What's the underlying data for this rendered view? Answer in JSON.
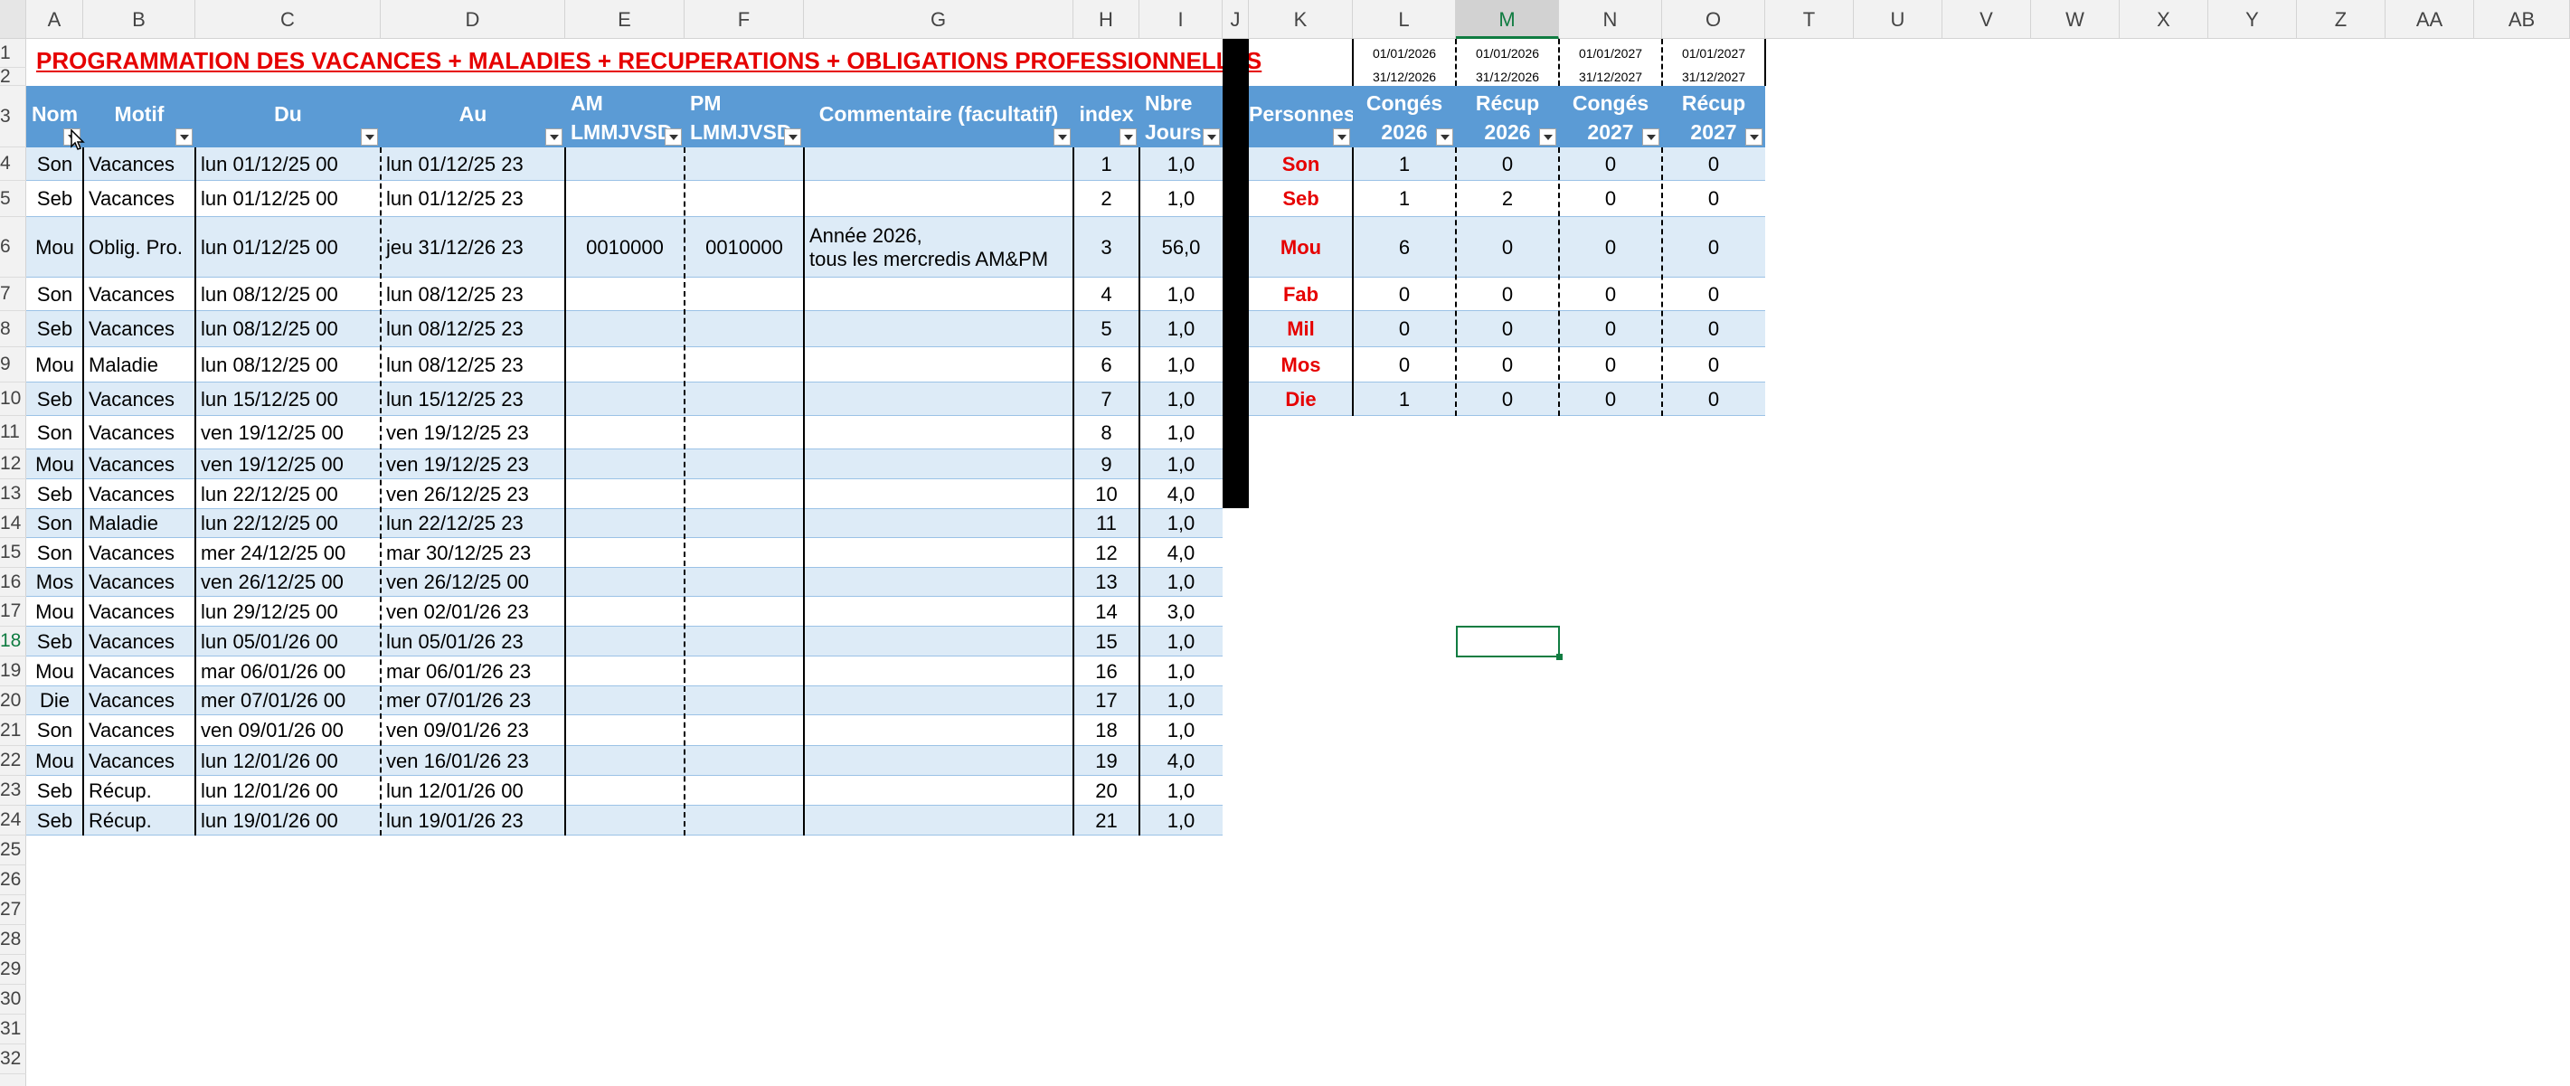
{
  "columns": [
    "A",
    "B",
    "C",
    "D",
    "E",
    "F",
    "G",
    "H",
    "I",
    "J",
    "K",
    "L",
    "M",
    "N",
    "O",
    "T",
    "U",
    "V",
    "W",
    "X",
    "Y",
    "Z",
    "AA",
    "AB"
  ],
  "selected_column": "M",
  "rows": [
    "1",
    "2",
    "3",
    "4",
    "5",
    "6",
    "7",
    "8",
    "9",
    "10",
    "11",
    "12",
    "13",
    "14",
    "15",
    "16",
    "17",
    "18",
    "19",
    "20",
    "21",
    "22",
    "23",
    "24",
    "25",
    "26",
    "27",
    "28",
    "29",
    "30",
    "31",
    "32"
  ],
  "selected_row": "18",
  "title": "PROGRAMMATION DES VACANCES + MALADIES + RECUPERATIONS + OBLIGATIONS PROFESSIONNELLES",
  "main_headers": [
    {
      "l1": "Nom"
    },
    {
      "l1": "Motif"
    },
    {
      "l1": "Du"
    },
    {
      "l1": "Au"
    },
    {
      "l1": "AM",
      "l2": "LMMJVSD"
    },
    {
      "l1": "PM",
      "l2": "LMMJVSD"
    },
    {
      "l1": "Commentaire (facultatif)"
    },
    {
      "l1": "index"
    },
    {
      "l1": "Nbre",
      "l2": "Jours"
    }
  ],
  "main_rows": [
    [
      "Son",
      "Vacances",
      "lun 01/12/25 00",
      "lun 01/12/25 23",
      "",
      "",
      "",
      "1",
      "1,0"
    ],
    [
      "Seb",
      "Vacances",
      "lun 01/12/25 00",
      "lun 01/12/25 23",
      "",
      "",
      "",
      "2",
      "1,0"
    ],
    [
      "Mou",
      "Oblig. Pro.",
      "lun 01/12/25 00",
      "jeu 31/12/26 23",
      "0010000",
      "0010000",
      "Année 2026,",
      "3",
      "56,0"
    ],
    [
      "Son",
      "Vacances",
      "lun 08/12/25 00",
      "lun 08/12/25 23",
      "",
      "",
      "",
      "4",
      "1,0"
    ],
    [
      "Seb",
      "Vacances",
      "lun 08/12/25 00",
      "lun 08/12/25 23",
      "",
      "",
      "",
      "5",
      "1,0"
    ],
    [
      "Mou",
      "Maladie",
      "lun 08/12/25 00",
      "lun 08/12/25 23",
      "",
      "",
      "",
      "6",
      "1,0"
    ],
    [
      "Seb",
      "Vacances",
      "lun 15/12/25 00",
      "lun 15/12/25 23",
      "",
      "",
      "",
      "7",
      "1,0"
    ],
    [
      "Son",
      "Vacances",
      "ven 19/12/25 00",
      "ven 19/12/25 23",
      "",
      "",
      "",
      "8",
      "1,0"
    ],
    [
      "Mou",
      "Vacances",
      "ven 19/12/25 00",
      "ven 19/12/25 23",
      "",
      "",
      "",
      "9",
      "1,0"
    ],
    [
      "Seb",
      "Vacances",
      "lun 22/12/25 00",
      "ven 26/12/25 23",
      "",
      "",
      "",
      "10",
      "4,0"
    ],
    [
      "Son",
      "Maladie",
      "lun 22/12/25 00",
      "lun 22/12/25 23",
      "",
      "",
      "",
      "11",
      "1,0"
    ],
    [
      "Son",
      "Vacances",
      "mer 24/12/25 00",
      "mar 30/12/25 23",
      "",
      "",
      "",
      "12",
      "4,0"
    ],
    [
      "Mos",
      "Vacances",
      "ven 26/12/25 00",
      "ven 26/12/25 00",
      "",
      "",
      "",
      "13",
      "1,0"
    ],
    [
      "Mou",
      "Vacances",
      "lun 29/12/25 00",
      "ven 02/01/26 23",
      "",
      "",
      "",
      "14",
      "3,0"
    ],
    [
      "Seb",
      "Vacances",
      "lun 05/01/26 00",
      "lun 05/01/26 23",
      "",
      "",
      "",
      "15",
      "1,0"
    ],
    [
      "Mou",
      "Vacances",
      "mar 06/01/26 00",
      "mar 06/01/26 23",
      "",
      "",
      "",
      "16",
      "1,0"
    ],
    [
      "Die",
      "Vacances",
      "mer 07/01/26 00",
      "mer 07/01/26 23",
      "",
      "",
      "",
      "17",
      "1,0"
    ],
    [
      "Son",
      "Vacances",
      "ven 09/01/26 00",
      "ven 09/01/26 23",
      "",
      "",
      "",
      "18",
      "1,0"
    ],
    [
      "Mou",
      "Vacances",
      "lun 12/01/26 00",
      "ven 16/01/26 23",
      "",
      "",
      "",
      "19",
      "4,0"
    ],
    [
      "Seb",
      "Récup.",
      "lun 12/01/26 00",
      "lun 12/01/26 00",
      "",
      "",
      "",
      "20",
      "1,0"
    ],
    [
      "Seb",
      "Récup.",
      "lun 19/01/26 00",
      "lun 19/01/26 23",
      "",
      "",
      "",
      "21",
      "1,0"
    ]
  ],
  "comment_line2": "tous les mercredis AM&PM",
  "summary_dates": [
    [
      "01/01/2026",
      "31/12/2026"
    ],
    [
      "01/01/2026",
      "31/12/2026"
    ],
    [
      "01/01/2027",
      "31/12/2027"
    ],
    [
      "01/01/2027",
      "31/12/2027"
    ]
  ],
  "summary_headers": [
    {
      "l1": "Personnes"
    },
    {
      "l1": "Congés",
      "l2": "2026"
    },
    {
      "l1": "Récup",
      "l2": "2026"
    },
    {
      "l1": "Congés",
      "l2": "2027"
    },
    {
      "l1": "Récup",
      "l2": "2027"
    }
  ],
  "summary_rows": [
    [
      "Son",
      "1",
      "0",
      "0",
      "0"
    ],
    [
      "Seb",
      "1",
      "2",
      "0",
      "0"
    ],
    [
      "Mou",
      "6",
      "0",
      "0",
      "0"
    ],
    [
      "Fab",
      "0",
      "0",
      "0",
      "0"
    ],
    [
      "Mil",
      "0",
      "0",
      "0",
      "0"
    ],
    [
      "Mos",
      "0",
      "0",
      "0",
      "0"
    ],
    [
      "Die",
      "1",
      "0",
      "0",
      "0"
    ]
  ],
  "icons": {
    "filter_dropdown": "chevron-down-icon",
    "cursor": "mouse-pointer-icon"
  },
  "colors": {
    "header_blue": "#5b9bd5",
    "band_blue": "#ddebf7",
    "title_red": "#e60000",
    "excel_green": "#107c41"
  }
}
